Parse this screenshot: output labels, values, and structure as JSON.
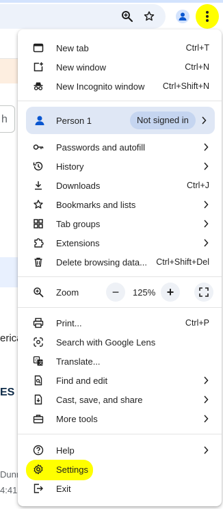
{
  "background": {
    "partial_texts": [
      "h",
      "erica",
      "ES",
      "Dunm",
      "4:41"
    ]
  },
  "toolbar": {
    "zoom_icon": "magnifier-zoom-icon",
    "bookmark_icon": "star-icon",
    "profile_icon": "person-icon",
    "menu_icon": "three-dots-vertical-icon",
    "highlight_color": "#ffff00"
  },
  "menu": {
    "new_tab": {
      "label": "New tab",
      "shortcut": "Ctrl+T"
    },
    "new_window": {
      "label": "New window",
      "shortcut": "Ctrl+N"
    },
    "new_incognito": {
      "label": "New Incognito window",
      "shortcut": "Ctrl+Shift+N"
    },
    "profile": {
      "name": "Person 1",
      "status": "Not signed in"
    },
    "passwords": {
      "label": "Passwords and autofill"
    },
    "history": {
      "label": "History"
    },
    "downloads": {
      "label": "Downloads",
      "shortcut": "Ctrl+J"
    },
    "bookmarks": {
      "label": "Bookmarks and lists"
    },
    "tab_groups": {
      "label": "Tab groups"
    },
    "extensions": {
      "label": "Extensions"
    },
    "delete_browsing": {
      "label": "Delete browsing data...",
      "shortcut": "Ctrl+Shift+Del"
    },
    "zoom": {
      "label": "Zoom",
      "value": "125%",
      "minus": "−",
      "plus": "+"
    },
    "print": {
      "label": "Print...",
      "shortcut": "Ctrl+P"
    },
    "lens": {
      "label": "Search with Google Lens"
    },
    "translate": {
      "label": "Translate..."
    },
    "find_edit": {
      "label": "Find and edit"
    },
    "cast_save": {
      "label": "Cast, save, and share"
    },
    "more_tools": {
      "label": "More tools"
    },
    "help": {
      "label": "Help"
    },
    "settings": {
      "label": "Settings"
    },
    "exit": {
      "label": "Exit"
    }
  }
}
